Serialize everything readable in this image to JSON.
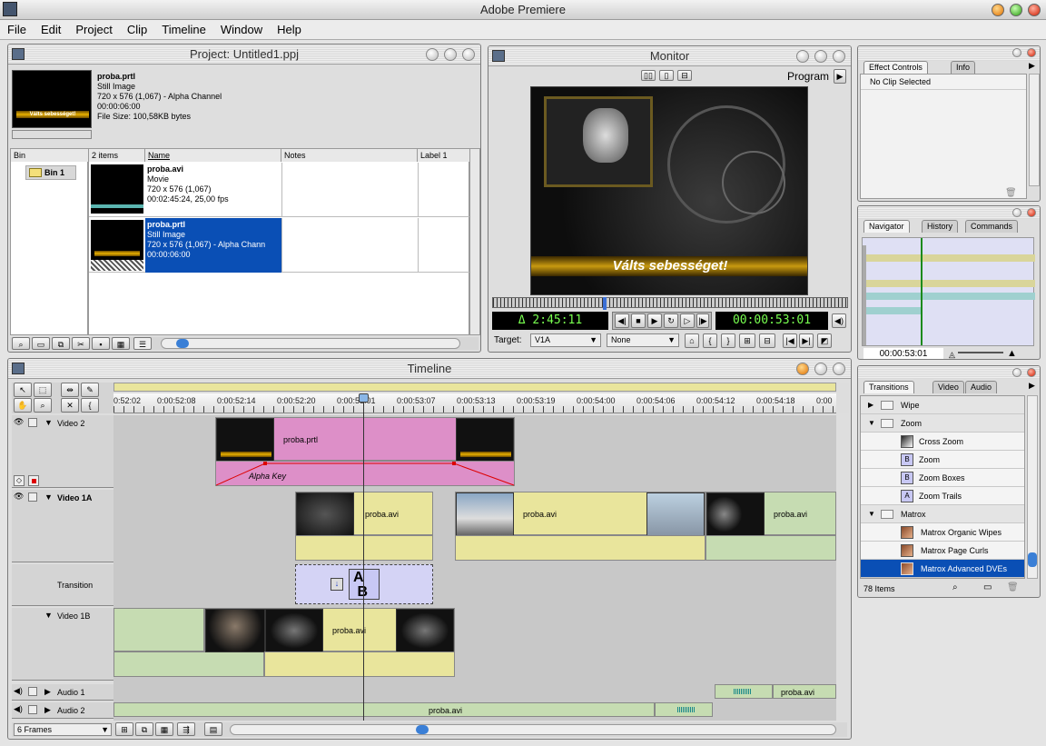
{
  "app": {
    "title": "Adobe Premiere"
  },
  "menu": [
    "File",
    "Edit",
    "Project",
    "Clip",
    "Timeline",
    "Window",
    "Help"
  ],
  "project": {
    "title": "Project: Untitled1.ppj",
    "preview": {
      "name": "proba.prtl",
      "type": "Still Image",
      "dims": "720 x 576 (1,067) - Alpha Channel",
      "duration": "00:00:06:00",
      "size": "File Size: 100,58KB bytes",
      "thumb_text": "Válts sebességet!"
    },
    "columns": {
      "bin": "Bin",
      "count": "2 items",
      "name": "Name",
      "notes": "Notes",
      "label": "Label 1"
    },
    "bin": "Bin 1",
    "items": [
      {
        "name": "proba.avi",
        "type": "Movie",
        "dims": "720 x 576 (1,067)",
        "duration": "00:02:45:24, 25,00 fps"
      },
      {
        "name": "proba.prtl",
        "type": "Still Image",
        "dims": "720 x 576 (1,067) - Alpha Chann",
        "duration": "00:00:06:00"
      }
    ]
  },
  "monitor": {
    "title": "Monitor",
    "mode": "Program",
    "overlay_text": "Válts sebességet!",
    "duration_tc": "Δ 2:45:11",
    "current_tc": "00:00:53:01",
    "target_label": "Target:",
    "target_video": "V1A",
    "target_audio": "None",
    "progress": 0.42
  },
  "effect_controls": {
    "tabs": [
      "Effect Controls",
      "Info"
    ],
    "status": "No Clip Selected"
  },
  "navigator": {
    "tabs": [
      "Navigator",
      "History",
      "Commands"
    ],
    "timecode": "00:00:53:01"
  },
  "transitions": {
    "tabs": [
      "Transitions",
      "Video",
      "Audio"
    ],
    "items": [
      {
        "label": "Wipe",
        "kind": "folder-closed"
      },
      {
        "label": "Zoom",
        "kind": "folder-open"
      },
      {
        "label": "Cross Zoom",
        "kind": "effect"
      },
      {
        "label": "Zoom",
        "kind": "effect"
      },
      {
        "label": "Zoom Boxes",
        "kind": "effect"
      },
      {
        "label": "Zoom Trails",
        "kind": "effect"
      },
      {
        "label": "Matrox",
        "kind": "folder-open"
      },
      {
        "label": "Matrox Organic Wipes",
        "kind": "effect"
      },
      {
        "label": "Matrox Page Curls",
        "kind": "effect"
      },
      {
        "label": "Matrox Advanced DVEs",
        "kind": "effect-selected"
      }
    ],
    "count": "78 Items"
  },
  "timeline": {
    "title": "Timeline",
    "ruler": [
      "0:52:02",
      "0:00:52:08",
      "0:00:52:14",
      "0:00:52:20",
      "0:00:53:01",
      "0:00:53:07",
      "0:00:53:13",
      "0:00:53:19",
      "0:00:54:00",
      "0:00:54:06",
      "0:00:54:12",
      "0:00:54:18",
      "0:00"
    ],
    "tracks": {
      "video2": "Video 2",
      "video1a": "Video 1A",
      "transition": "Transition",
      "video1b": "Video 1B",
      "audio1": "Audio 1",
      "audio2": "Audio 2"
    },
    "clips": {
      "v2_clip": "proba.prtl",
      "alpha_key": "Alpha Key",
      "v1a_clip1": "proba.avi",
      "v1a_clip2": "proba.avi",
      "v1a_clip3": "proba.avi",
      "v1b_clip": "proba.avi",
      "a1_clip": "proba.avi",
      "a2_clip": "proba.avi"
    },
    "frames": "6 Frames"
  },
  "colors": {
    "selection": "#0a4fb5",
    "video_clip": "#e9e59c",
    "title_clip": "#dd8fc8",
    "audio_clip": "#c6dcb2",
    "transition": "#d4d3f5",
    "timecode": "#78ff50"
  }
}
